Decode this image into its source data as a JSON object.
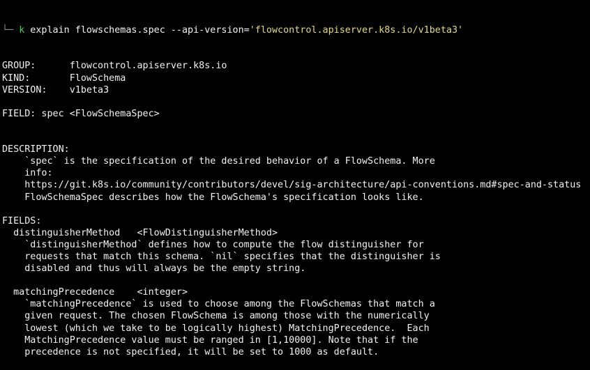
{
  "prompt": {
    "tree_glyph": "└─ ",
    "command": "k",
    "args": " explain flowschemas.spec --api-version=",
    "quoted_value": "'flowcontrol.apiserver.k8s.io/v1beta3'"
  },
  "colors": {
    "background": "#000000",
    "text": "#f2f2f2",
    "command": "#4fd14f",
    "string": "#e6db74",
    "tree": "#8a8a8a"
  },
  "lines": [
    "GROUP:      flowcontrol.apiserver.k8s.io",
    "KIND:       FlowSchema",
    "VERSION:    v1beta3",
    "",
    "FIELD: spec <FlowSchemaSpec>",
    "",
    "",
    "DESCRIPTION:",
    "    `spec` is the specification of the desired behavior of a FlowSchema. More",
    "    info:",
    "    https://git.k8s.io/community/contributors/devel/sig-architecture/api-conventions.md#spec-and-status",
    "    FlowSchemaSpec describes how the FlowSchema's specification looks like.",
    "",
    "FIELDS:",
    "  distinguisherMethod   <FlowDistinguisherMethod>",
    "    `distinguisherMethod` defines how to compute the flow distinguisher for",
    "    requests that match this schema. `nil` specifies that the distinguisher is",
    "    disabled and thus will always be the empty string.",
    "",
    "  matchingPrecedence    <integer>",
    "    `matchingPrecedence` is used to choose among the FlowSchemas that match a",
    "    given request. The chosen FlowSchema is among those with the numerically",
    "    lowest (which we take to be logically highest) MatchingPrecedence.  Each",
    "    MatchingPrecedence value must be ranged in [1,10000]. Note that if the",
    "    precedence is not specified, it will be set to 1000 as default."
  ]
}
